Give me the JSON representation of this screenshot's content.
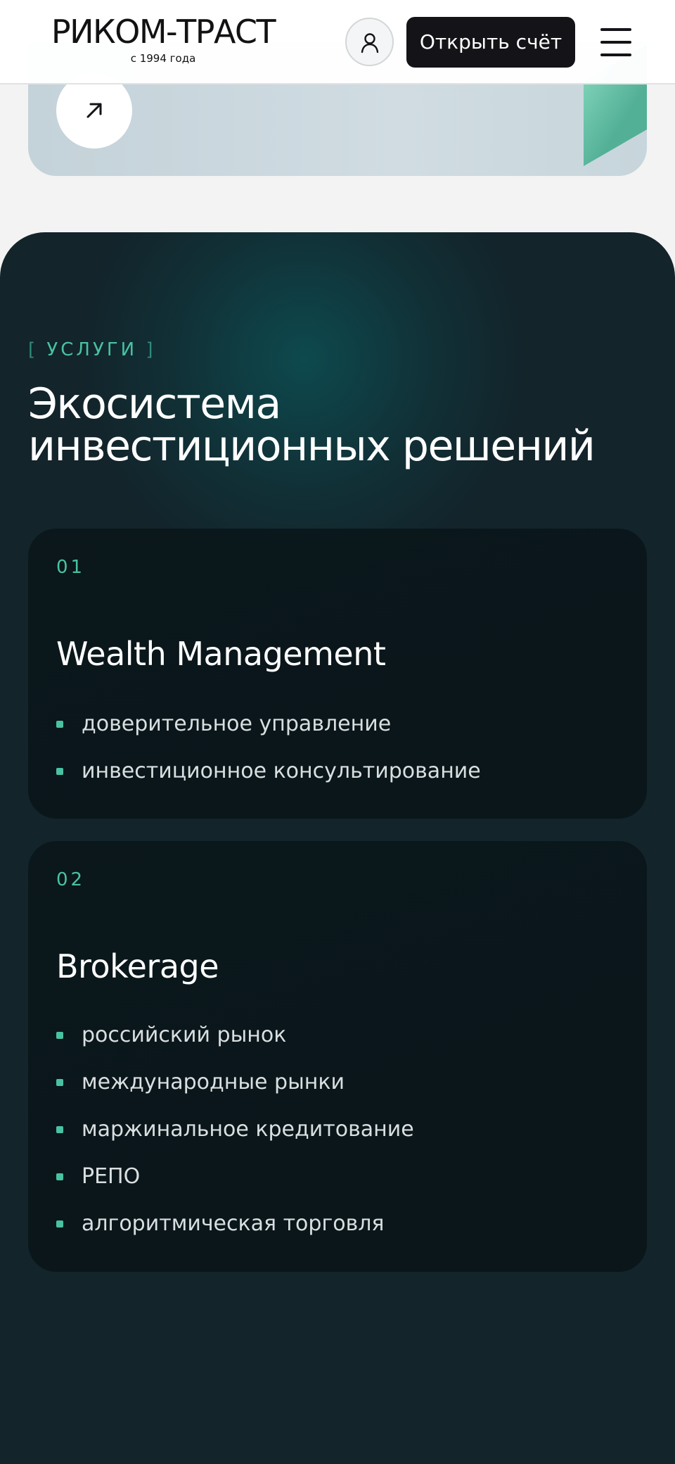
{
  "header": {
    "logo_name": "РИКОМ-ТРАСТ",
    "logo_since": "с 1994 года",
    "account_icon": "user-icon",
    "open_account_label": "Открыть счёт",
    "menu_icon": "hamburger-menu-icon"
  },
  "hero": {
    "arrow_icon": "arrow-up-right-icon"
  },
  "services": {
    "tag": "УСЛУГИ",
    "title": "Экосистема инвестиционных решений",
    "accent_color": "#49c2a1",
    "background_color": "#13242b",
    "cards": [
      {
        "number": "01",
        "title": "Wealth Management",
        "items": [
          "доверительное управление",
          "инвестиционное консультирование"
        ]
      },
      {
        "number": "02",
        "title": "Brokerage",
        "items": [
          "российский рынок",
          "международные рынки",
          "маржинальное кредитование",
          "РЕПО",
          "алгоритмическая торговля"
        ]
      }
    ]
  }
}
